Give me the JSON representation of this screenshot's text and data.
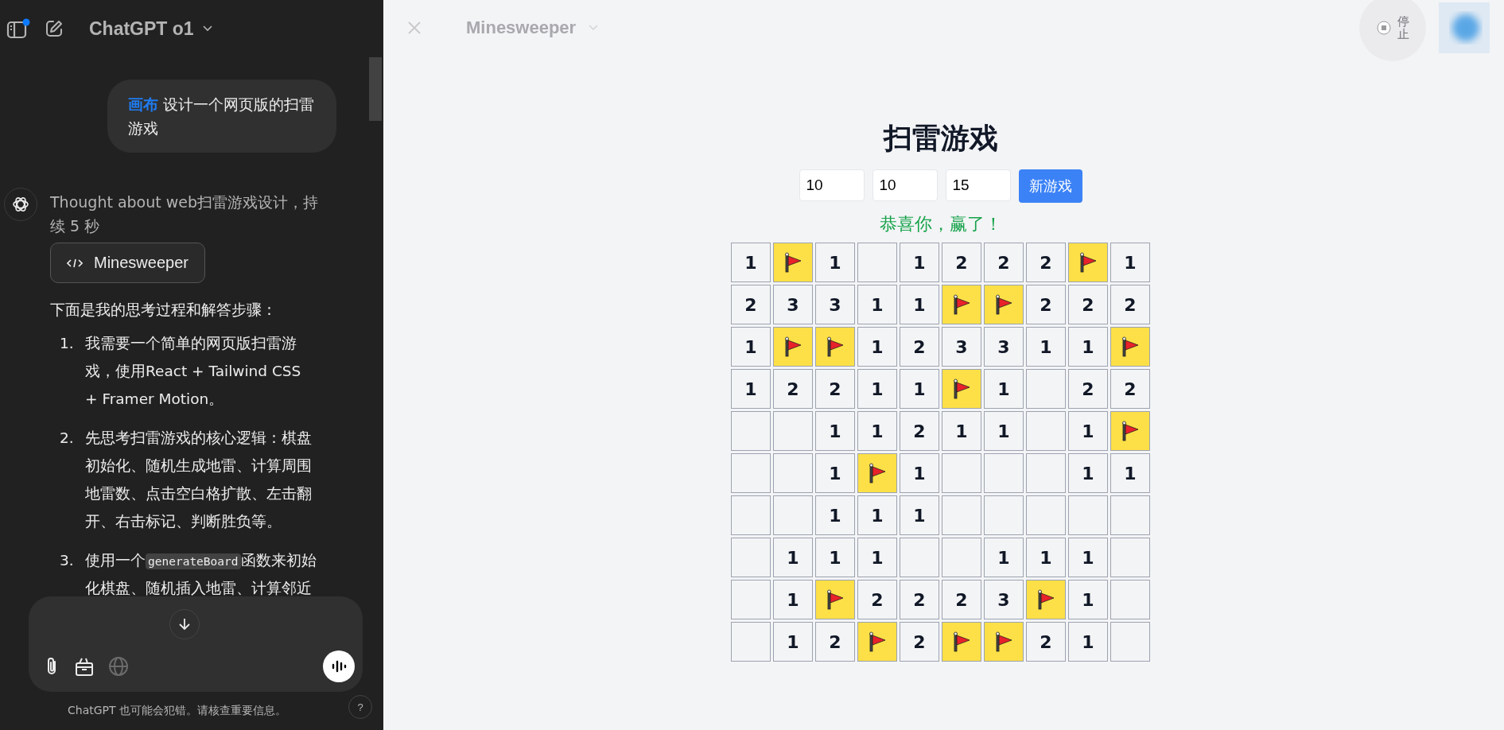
{
  "sidebar": {
    "notification": true,
    "model": "ChatGPT o1",
    "messages": [
      {
        "kind": "user",
        "tag": "画布",
        "text": "设计一个网页版的扫雷游戏"
      },
      {
        "kind": "assistant",
        "thought": "Thought about web扫雷游戏设计，持续 5 秒",
        "artifact": "Minesweeper",
        "intro": "下面是我的思考过程和解答步骤：",
        "steps": [
          {
            "marker": "1.",
            "before": "我需要一个简单的网页版扫雷游戏，使用React + Tailwind CSS + Framer Motion。"
          },
          {
            "marker": "2.",
            "before": "先思考扫雷游戏的核心逻辑：棋盘初始化、随机生成地雷、计算周围地雷数、点击空白格扩散、左击翻开、右击标记、判断胜负等。"
          },
          {
            "marker": "3.",
            "before": "使用一个",
            "code": "generateBoard",
            "after": "函数来初始化棋盘、随机插入地雷、计算邻近"
          }
        ]
      }
    ],
    "disclaimer": "ChatGPT 也可能会犯错。请核查重要信息。",
    "help": "?"
  },
  "canvas": {
    "title": "Minesweeper",
    "stop": "停止"
  },
  "game": {
    "title": "扫雷游戏",
    "inputs": [
      "10",
      "10",
      "15"
    ],
    "button": "新游戏",
    "message": "恭喜你，赢了！",
    "board": [
      [
        {
          "kind": "number",
          "text": "1"
        },
        {
          "kind": "flag"
        },
        {
          "kind": "number",
          "text": "1"
        },
        {
          "kind": "blank"
        },
        {
          "kind": "number",
          "text": "1"
        },
        {
          "kind": "number",
          "text": "2"
        },
        {
          "kind": "number",
          "text": "2"
        },
        {
          "kind": "number",
          "text": "2"
        },
        {
          "kind": "flag"
        },
        {
          "kind": "number",
          "text": "1"
        }
      ],
      [
        {
          "kind": "number",
          "text": "2"
        },
        {
          "kind": "number",
          "text": "3"
        },
        {
          "kind": "number",
          "text": "3"
        },
        {
          "kind": "number",
          "text": "1"
        },
        {
          "kind": "number",
          "text": "1"
        },
        {
          "kind": "flag"
        },
        {
          "kind": "flag"
        },
        {
          "kind": "number",
          "text": "2"
        },
        {
          "kind": "number",
          "text": "2"
        },
        {
          "kind": "number",
          "text": "2"
        }
      ],
      [
        {
          "kind": "number",
          "text": "1"
        },
        {
          "kind": "flag"
        },
        {
          "kind": "flag"
        },
        {
          "kind": "number",
          "text": "1"
        },
        {
          "kind": "number",
          "text": "2"
        },
        {
          "kind": "number",
          "text": "3"
        },
        {
          "kind": "number",
          "text": "3"
        },
        {
          "kind": "number",
          "text": "1"
        },
        {
          "kind": "number",
          "text": "1"
        },
        {
          "kind": "flag"
        }
      ],
      [
        {
          "kind": "number",
          "text": "1"
        },
        {
          "kind": "number",
          "text": "2"
        },
        {
          "kind": "number",
          "text": "2"
        },
        {
          "kind": "number",
          "text": "1"
        },
        {
          "kind": "number",
          "text": "1"
        },
        {
          "kind": "flag"
        },
        {
          "kind": "number",
          "text": "1"
        },
        {
          "kind": "blank"
        },
        {
          "kind": "number",
          "text": "2"
        },
        {
          "kind": "number",
          "text": "2"
        }
      ],
      [
        {
          "kind": "blank"
        },
        {
          "kind": "blank"
        },
        {
          "kind": "number",
          "text": "1"
        },
        {
          "kind": "number",
          "text": "1"
        },
        {
          "kind": "number",
          "text": "2"
        },
        {
          "kind": "number",
          "text": "1"
        },
        {
          "kind": "number",
          "text": "1"
        },
        {
          "kind": "blank"
        },
        {
          "kind": "number",
          "text": "1"
        },
        {
          "kind": "flag"
        }
      ],
      [
        {
          "kind": "blank"
        },
        {
          "kind": "blank"
        },
        {
          "kind": "number",
          "text": "1"
        },
        {
          "kind": "flag"
        },
        {
          "kind": "number",
          "text": "1"
        },
        {
          "kind": "blank"
        },
        {
          "kind": "blank"
        },
        {
          "kind": "blank"
        },
        {
          "kind": "number",
          "text": "1"
        },
        {
          "kind": "number",
          "text": "1"
        }
      ],
      [
        {
          "kind": "blank"
        },
        {
          "kind": "blank"
        },
        {
          "kind": "number",
          "text": "1"
        },
        {
          "kind": "number",
          "text": "1"
        },
        {
          "kind": "number",
          "text": "1"
        },
        {
          "kind": "blank"
        },
        {
          "kind": "blank"
        },
        {
          "kind": "blank"
        },
        {
          "kind": "blank"
        },
        {
          "kind": "blank"
        }
      ],
      [
        {
          "kind": "blank"
        },
        {
          "kind": "number",
          "text": "1"
        },
        {
          "kind": "number",
          "text": "1"
        },
        {
          "kind": "number",
          "text": "1"
        },
        {
          "kind": "blank"
        },
        {
          "kind": "blank"
        },
        {
          "kind": "number",
          "text": "1"
        },
        {
          "kind": "number",
          "text": "1"
        },
        {
          "kind": "number",
          "text": "1"
        },
        {
          "kind": "blank"
        }
      ],
      [
        {
          "kind": "blank"
        },
        {
          "kind": "number",
          "text": "1"
        },
        {
          "kind": "flag"
        },
        {
          "kind": "number",
          "text": "2"
        },
        {
          "kind": "number",
          "text": "2"
        },
        {
          "kind": "number",
          "text": "2"
        },
        {
          "kind": "number",
          "text": "3"
        },
        {
          "kind": "flag"
        },
        {
          "kind": "number",
          "text": "1"
        },
        {
          "kind": "blank"
        }
      ],
      [
        {
          "kind": "blank"
        },
        {
          "kind": "number",
          "text": "1"
        },
        {
          "kind": "number",
          "text": "2"
        },
        {
          "kind": "flag"
        },
        {
          "kind": "number",
          "text": "2"
        },
        {
          "kind": "flag"
        },
        {
          "kind": "flag"
        },
        {
          "kind": "number",
          "text": "2"
        },
        {
          "kind": "number",
          "text": "1"
        },
        {
          "kind": "blank"
        }
      ]
    ]
  }
}
